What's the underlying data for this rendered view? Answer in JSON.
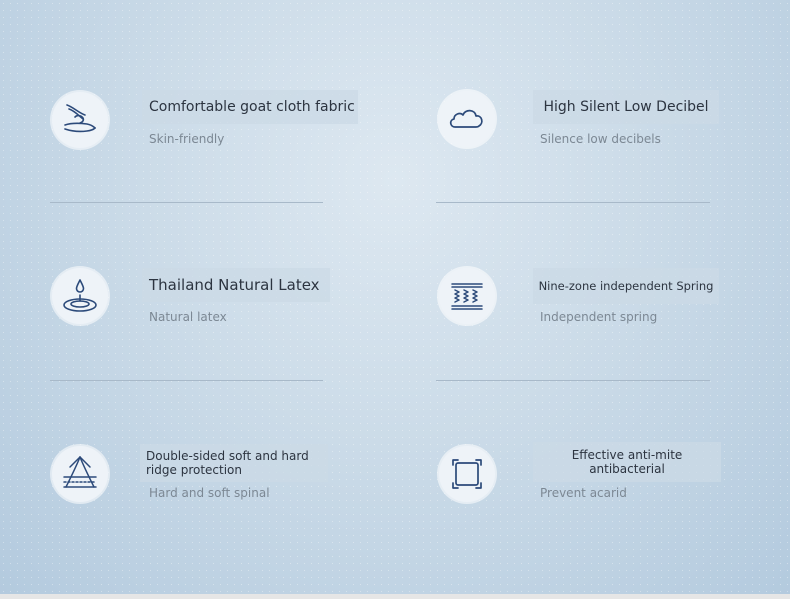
{
  "features": [
    {
      "title": "Comfortable goat cloth fabric",
      "subtitle": "Skin-friendly",
      "icon": "hand-fabric-icon"
    },
    {
      "title": "High Silent Low Decibel",
      "subtitle": "Silence low decibels",
      "icon": "cloud-icon"
    },
    {
      "title": "Thailand Natural Latex",
      "subtitle": "Natural latex",
      "icon": "latex-drop-icon"
    },
    {
      "title": "Nine-zone independent Spring",
      "subtitle": "Independent spring",
      "icon": "spring-icon"
    },
    {
      "title": "Double-sided soft and hard ridge protection",
      "subtitle": "Hard and soft spinal",
      "icon": "spinal-arrow-icon"
    },
    {
      "title": "Effective anti-mite antibacterial",
      "subtitle": "Prevent acarid",
      "icon": "anti-mite-frame-icon"
    }
  ],
  "colors": {
    "icon_stroke": "#2c4a7a",
    "title_text": "#2c3440",
    "subtitle_text": "#7c8894"
  }
}
